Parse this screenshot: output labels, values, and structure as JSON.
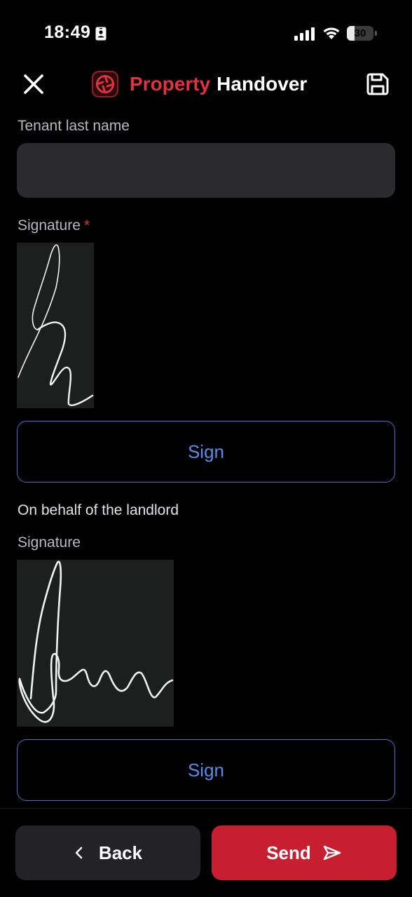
{
  "status_bar": {
    "time": "18:49",
    "battery_label": "30",
    "battery_level": 0.3,
    "icons": [
      "id-card-icon",
      "cellular-signal-icon",
      "wifi-icon",
      "battery-icon"
    ]
  },
  "header": {
    "title_accent": "Property",
    "title_main": "Handover",
    "icons": [
      "close-icon",
      "app-logo-icon",
      "save-icon"
    ]
  },
  "tenant": {
    "last_name_label": "Tenant last name",
    "last_name_value": "",
    "signature_label": "Signature",
    "signature_required_mark": "*",
    "sign_button_label": "Sign"
  },
  "landlord": {
    "section_label": "On behalf of the landlord",
    "signature_label": "Signature",
    "sign_button_label": "Sign"
  },
  "footer": {
    "back_label": "Back",
    "send_label": "Send",
    "icons": [
      "chevron-left-icon",
      "send-icon"
    ]
  },
  "colors": {
    "background": "#000000",
    "accent_red": "#e0323f",
    "send_button_red": "#c71f2f",
    "input_background": "#2a2a2f",
    "signature_background": "#1d1f1e",
    "sign_button_border": "#4a6fd0",
    "sign_button_text": "#5b8ae8",
    "label_gray": "#b9b9bf"
  }
}
